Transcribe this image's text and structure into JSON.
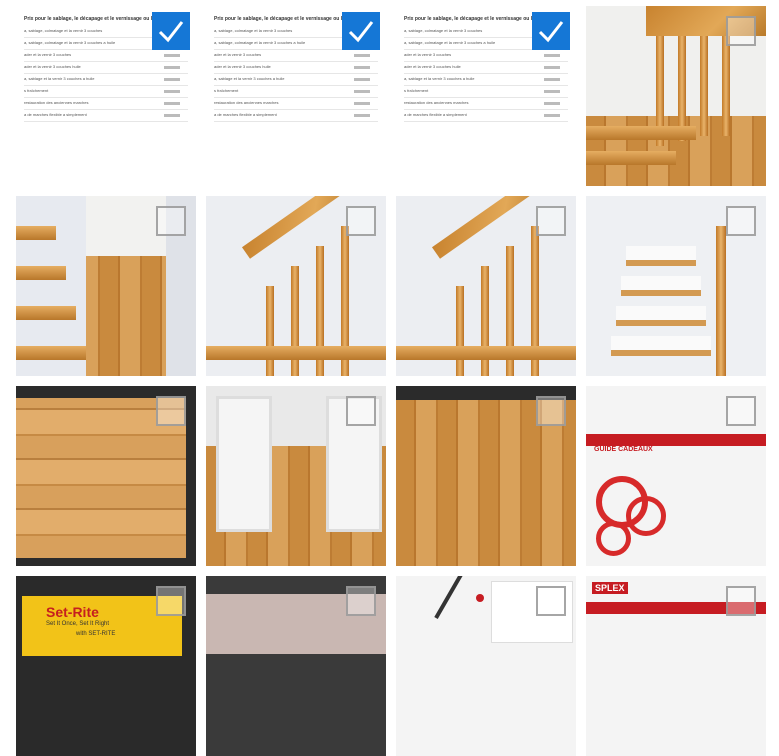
{
  "colors": {
    "accent": "#1577d6",
    "checkbox_border": "#969696"
  },
  "icons": {
    "checkmark": "check-icon"
  },
  "tiles": [
    {
      "id": "t1",
      "kind": "document",
      "selected": true
    },
    {
      "id": "t2",
      "kind": "document",
      "selected": true
    },
    {
      "id": "t3",
      "kind": "document",
      "selected": true
    },
    {
      "id": "t4",
      "kind": "stair-photo",
      "selected": false
    },
    {
      "id": "t5",
      "kind": "stair-photo",
      "selected": false
    },
    {
      "id": "t6",
      "kind": "stair-photo",
      "selected": false
    },
    {
      "id": "t7",
      "kind": "stair-photo",
      "selected": false
    },
    {
      "id": "t8",
      "kind": "stair-photo",
      "selected": false
    },
    {
      "id": "t9",
      "kind": "floor-photo",
      "selected": false
    },
    {
      "id": "t10",
      "kind": "floor-photo",
      "selected": false
    },
    {
      "id": "t11",
      "kind": "floor-photo",
      "selected": false
    },
    {
      "id": "t12",
      "kind": "web-page",
      "selected": false
    },
    {
      "id": "t13",
      "kind": "video-frame",
      "selected": false
    },
    {
      "id": "t14",
      "kind": "video-frame",
      "selected": false
    },
    {
      "id": "t15",
      "kind": "product-page",
      "selected": false
    },
    {
      "id": "t16",
      "kind": "web-page",
      "selected": false
    }
  ],
  "doc": {
    "title": "Prix pour le sablage, le décapage et le vernissage ou l'huilage",
    "rows": [
      "a, sablage, colmatage et la vernir 3 couches",
      "a, sablage, colmatage et la vernir 3 couches a huile",
      "ader et la vernir 3 couches",
      "ader et la vernir 3 couches huile",
      "a, sablage et la vernir 3 couches a huile",
      "s fraîchement",
      "restauration des anciennes marches",
      "a de marches flexible a simplement"
    ]
  },
  "t13": {
    "caption": "Set-Rite",
    "sub": "Set It Once, Set It Right",
    "sub2": "with SET-RITE"
  },
  "t12": {
    "banner": "GUIDE CADEAUX"
  },
  "t16": {
    "logo": "SPLEX"
  }
}
